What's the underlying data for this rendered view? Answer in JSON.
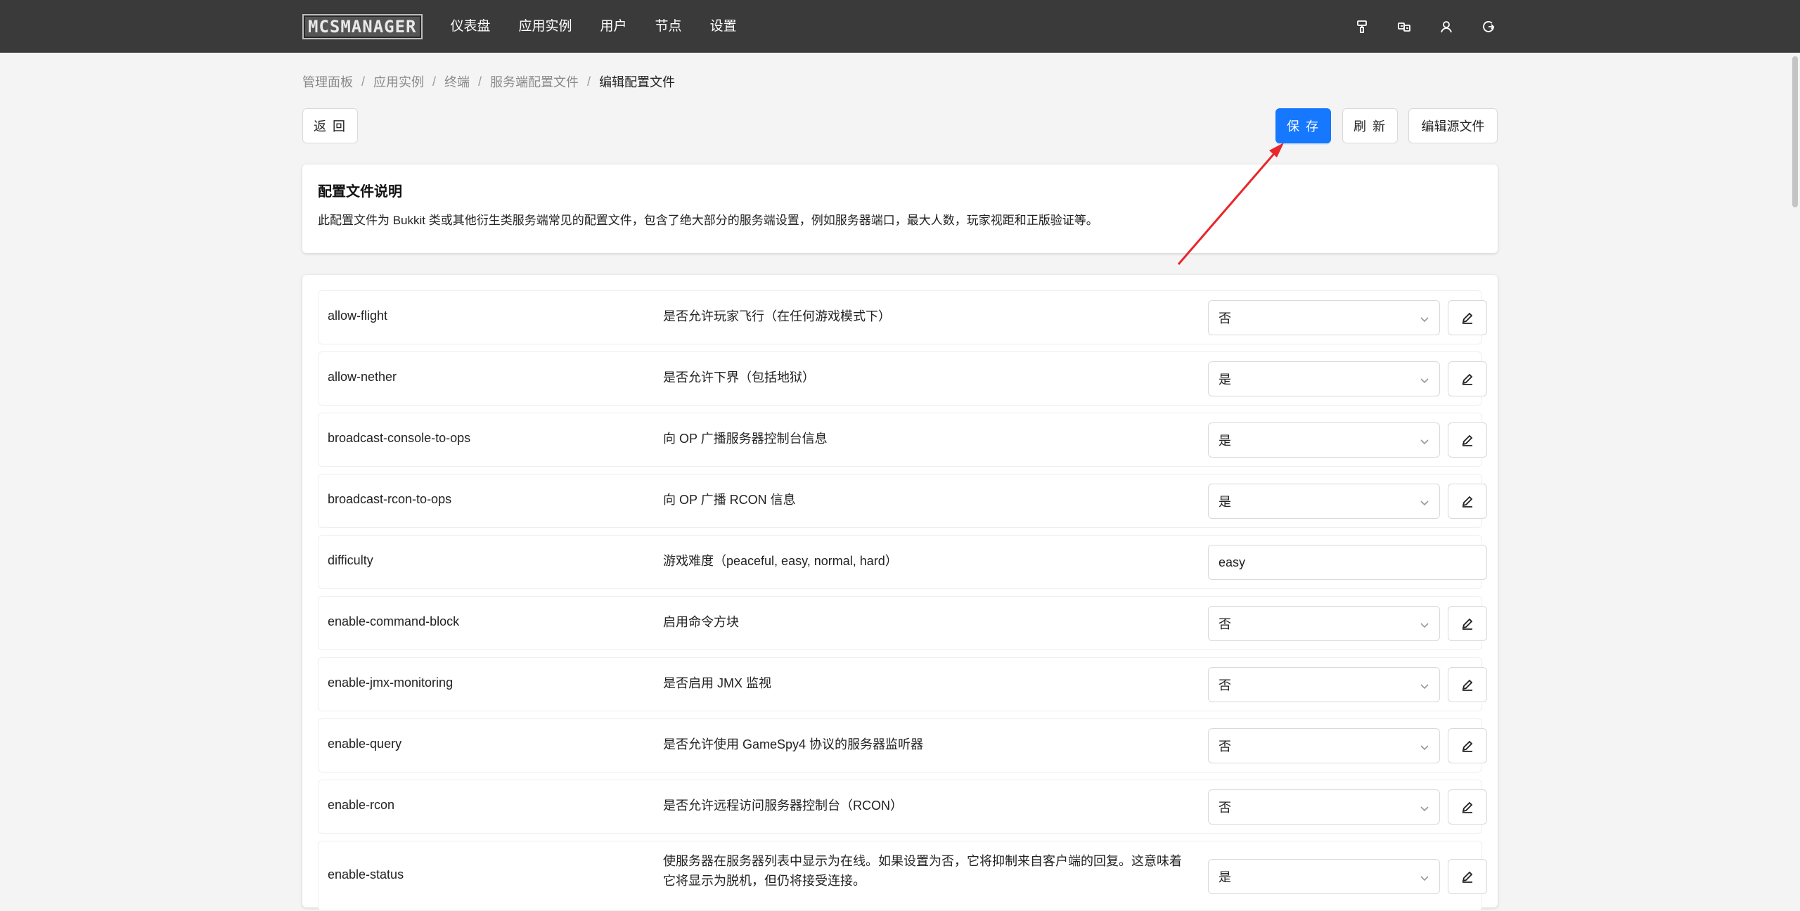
{
  "app": {
    "logo_text": "MCSMANAGER",
    "nav": [
      "仪表盘",
      "应用实例",
      "用户",
      "节点",
      "设置"
    ],
    "top_icons": [
      "theme-brush-icon",
      "language-icon",
      "user-icon",
      "logout-icon"
    ]
  },
  "breadcrumb": {
    "items": [
      "管理面板",
      "应用实例",
      "终端",
      "服务端配置文件"
    ],
    "current": "编辑配置文件",
    "separator": "/"
  },
  "actions": {
    "back_label": "返 回",
    "save_label": "保 存",
    "refresh_label": "刷 新",
    "edit_source_label": "编辑源文件"
  },
  "description": {
    "title": "配置文件说明",
    "text": "此配置文件为 Bukkit 类或其他衍生类服务端常见的配置文件，包含了绝大部分的服务端设置，例如服务器端口，最大人数，玩家视距和正版验证等。"
  },
  "config_rows": [
    {
      "key": "allow-flight",
      "desc": "是否允许玩家飞行（在任何游戏模式下）",
      "value": "否",
      "type": "select"
    },
    {
      "key": "allow-nether",
      "desc": "是否允许下界（包括地狱）",
      "value": "是",
      "type": "select"
    },
    {
      "key": "broadcast-console-to-ops",
      "desc": "向 OP 广播服务器控制台信息",
      "value": "是",
      "type": "select"
    },
    {
      "key": "broadcast-rcon-to-ops",
      "desc": "向 OP 广播 RCON 信息",
      "value": "是",
      "type": "select"
    },
    {
      "key": "difficulty",
      "desc": "游戏难度（peaceful, easy, normal, hard）",
      "value": "easy",
      "type": "input"
    },
    {
      "key": "enable-command-block",
      "desc": "启用命令方块",
      "value": "否",
      "type": "select"
    },
    {
      "key": "enable-jmx-monitoring",
      "desc": "是否启用 JMX 监视",
      "value": "否",
      "type": "select"
    },
    {
      "key": "enable-query",
      "desc": "是否允许使用 GameSpy4 协议的服务器监听器",
      "value": "否",
      "type": "select"
    },
    {
      "key": "enable-rcon",
      "desc": "是否允许远程访问服务器控制台（RCON）",
      "value": "否",
      "type": "select"
    },
    {
      "key": "enable-status",
      "desc": "使服务器在服务器列表中显示为在线。如果设置为否，它将抑制来自客户端的回复。这意味着它将显示为脱机，但仍将接受连接。",
      "value": "是",
      "type": "select"
    }
  ],
  "colors": {
    "topbar": "#3a3a3a",
    "primary": "#1677ff",
    "background": "#f4f4f4",
    "annotation_arrow": "#e8262b"
  }
}
